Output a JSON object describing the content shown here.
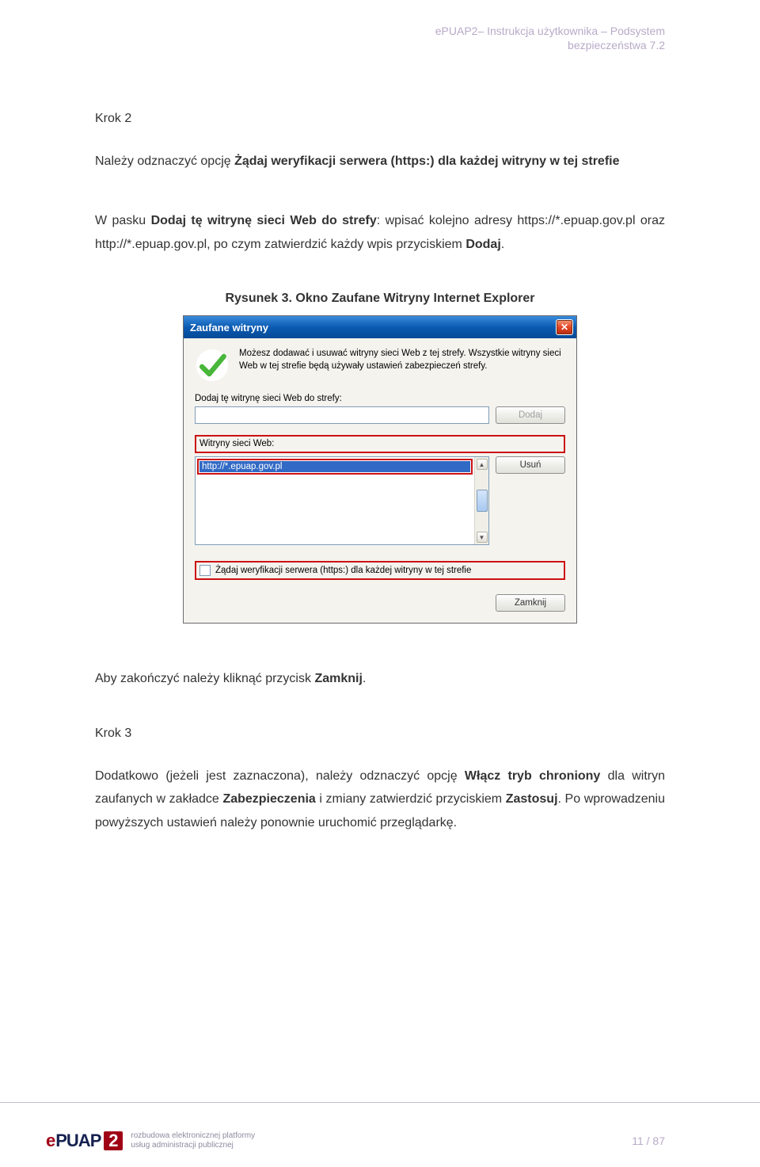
{
  "header": {
    "line1": "ePUAP2– Instrukcja użytkownika – Podsystem",
    "line2": "bezpieczeństwa 7.2"
  },
  "body": {
    "krok2": "Krok 2",
    "p1_parts": {
      "a": "Należy odznaczyć opcję ",
      "b_bold": "Żądaj weryfikacji serwera (https:) dla każdej witryny w tej strefie",
      "after": ""
    },
    "p2_parts": {
      "a": "W pasku ",
      "b_bold": "Dodaj tę witrynę sieci Web do strefy",
      "c": ": wpisać kolejno adresy https://*.epuap.gov.pl oraz http://*.epuap.gov.pl, po czym zatwierdzić każdy wpis przyciskiem ",
      "d_bold": "Dodaj",
      "e": "."
    },
    "fig_caption": "Rysunek 3. Okno Zaufane Witryny Internet Explorer",
    "p3_parts": {
      "a": "Aby zakończyć należy kliknąć przycisk ",
      "b_bold": "Zamknij",
      "c": "."
    },
    "krok3": "Krok 3",
    "p4_parts": {
      "a": "Dodatkowo (jeżeli jest zaznaczona), należy odznaczyć opcję ",
      "b_bold": "Włącz tryb chroniony",
      "c": " dla witryn zaufanych w zakładce ",
      "d_bold": "Zabezpieczenia",
      "e": " i zmiany zatwierdzić przyciskiem ",
      "f_bold": "Zastosuj",
      "g": ". Po wprowadzeniu powyższych ustawień należy ponownie uruchomić przeglądarkę."
    }
  },
  "dialog": {
    "title": "Zaufane witryny",
    "info": "Możesz dodawać i usuwać witryny sieci Web z tej strefy. Wszystkie witryny sieci Web w tej strefie będą używały ustawień zabezpieczeń strefy.",
    "add_label": "Dodaj tę witrynę sieci Web do strefy:",
    "list_label": "Witryny sieci Web:",
    "list_item": "http://*.epuap.gov.pl",
    "chk_label": "Żądaj weryfikacji serwera (https:) dla każdej witryny w tej strefie",
    "btn_add": "Dodaj",
    "btn_remove": "Usuń",
    "btn_close": "Zamknij"
  },
  "footer": {
    "logo_e": "e",
    "logo_puap": "PUAP",
    "logo_2": "2",
    "logo_sub1": "rozbudowa elektronicznej platformy",
    "logo_sub2": "usług administracji publicznej",
    "page_num": "11 / 87"
  }
}
